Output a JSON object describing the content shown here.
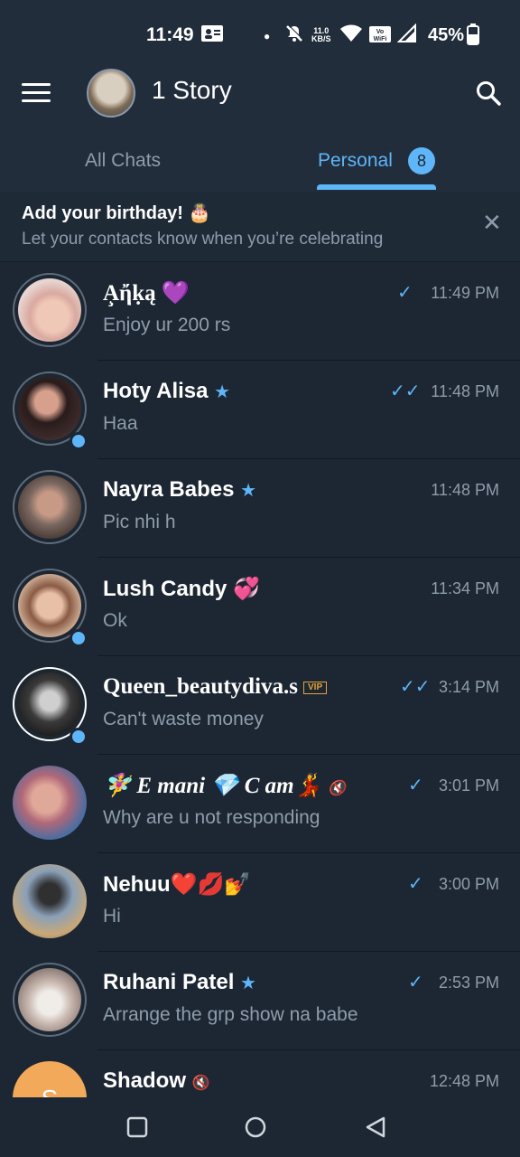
{
  "status": {
    "time": "11:49",
    "net_speed_top": "11.0",
    "net_speed_unit": "KB/S",
    "volte_label": "Vo₉ WiFi",
    "battery": "45%"
  },
  "header": {
    "title": "1 Story"
  },
  "tabs": [
    {
      "label": "All Chats"
    },
    {
      "label": "Personal",
      "badge": "8"
    }
  ],
  "banner": {
    "title": "Add your birthday! 🎂",
    "subtitle": "Let your contacts know when you’re celebrating"
  },
  "chats": [
    {
      "name": "A̧ĥíḳą",
      "display": "A̧ἤḳą",
      "badge": "💜",
      "message": "Enjoy ur 200 rs",
      "time": "11:49 PM",
      "check": "single"
    },
    {
      "name": "Hoty Alisa",
      "message": "Haa",
      "time": "11:48 PM",
      "check": "double"
    },
    {
      "name": "Nayra Babes",
      "message": "Pic nhi h",
      "time": "11:48 PM",
      "check": "none"
    },
    {
      "name": "Lush Candy",
      "badge": "💞",
      "message": "Ok",
      "time": "11:34 PM",
      "check": "none"
    },
    {
      "name": "Queen_beautydiva.s",
      "vip": "VIP",
      "message": "Can't waste money",
      "time": "3:14 PM",
      "check": "double"
    },
    {
      "name": "🧚‍♀️ E mani 💎 C am💃",
      "message": "Why are u not responding",
      "time": "3:01 PM",
      "check": "single"
    },
    {
      "name": "Nehuu❤️💋💅",
      "message": "Hi",
      "time": "3:00 PM",
      "check": "single"
    },
    {
      "name": "Ruhani Patel",
      "message": "Arrange the grp show na babe",
      "time": "2:53 PM",
      "check": "single"
    },
    {
      "name": "Shadow",
      "avatar_letter": "S",
      "message": "",
      "time": "12:48 PM",
      "check": "none"
    }
  ],
  "colors": {
    "accent": "#5eb5f7",
    "background": "#1d2733",
    "header": "#212d3b",
    "secondary_text": "#8e9cab"
  }
}
